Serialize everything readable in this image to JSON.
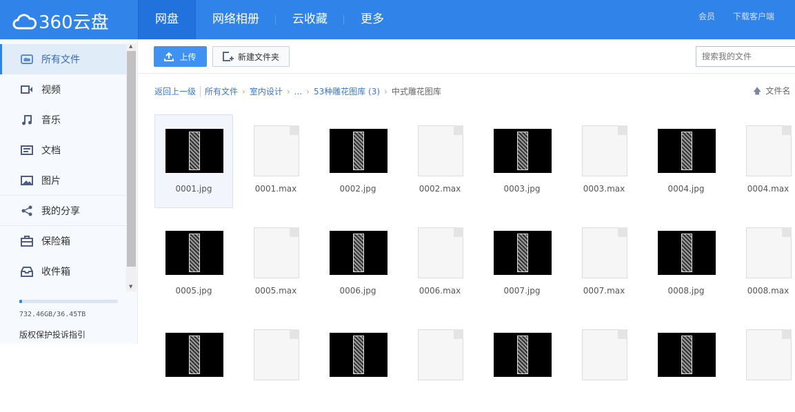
{
  "header": {
    "logo": "360云盘",
    "nav": [
      "网盘",
      "网络相册",
      "云收藏",
      "更多"
    ],
    "right": [
      "会员",
      "下载客户端"
    ]
  },
  "sidebar": {
    "items": [
      {
        "label": "所有文件",
        "icon": "folder-cloud-icon"
      },
      {
        "label": "视频",
        "icon": "video-icon"
      },
      {
        "label": "音乐",
        "icon": "music-icon"
      },
      {
        "label": "文档",
        "icon": "document-icon"
      },
      {
        "label": "图片",
        "icon": "image-icon"
      },
      {
        "label": "我的分享",
        "icon": "share-icon"
      },
      {
        "label": "保险箱",
        "icon": "safe-icon"
      },
      {
        "label": "收件箱",
        "icon": "inbox-icon"
      }
    ],
    "quota_text": "732.46GB/36.45TB",
    "quota_percent": 2,
    "copyright": "版权保护投诉指引"
  },
  "toolbar": {
    "upload": "上传",
    "new_folder": "新建文件夹",
    "search_placeholder": "搜索我的文件"
  },
  "breadcrumb": {
    "back": "返回上一级",
    "items": [
      "所有文件",
      "室内设计",
      "...",
      "53种雕花图库 (3)"
    ],
    "current": "中式雕花图库"
  },
  "sort": {
    "label": "文件名"
  },
  "files": [
    {
      "name": "0001.jpg",
      "type": "jpg"
    },
    {
      "name": "0001.max",
      "type": "max"
    },
    {
      "name": "0002.jpg",
      "type": "jpg"
    },
    {
      "name": "0002.max",
      "type": "max"
    },
    {
      "name": "0003.jpg",
      "type": "jpg"
    },
    {
      "name": "0003.max",
      "type": "max"
    },
    {
      "name": "0004.jpg",
      "type": "jpg"
    },
    {
      "name": "0004.max",
      "type": "max"
    },
    {
      "name": "0005.jpg",
      "type": "jpg"
    },
    {
      "name": "0005.max",
      "type": "max"
    },
    {
      "name": "0006.jpg",
      "type": "jpg"
    },
    {
      "name": "0006.max",
      "type": "max"
    },
    {
      "name": "0007.jpg",
      "type": "jpg"
    },
    {
      "name": "0007.max",
      "type": "max"
    },
    {
      "name": "0008.jpg",
      "type": "jpg"
    },
    {
      "name": "0008.max",
      "type": "max"
    },
    {
      "name": "",
      "type": "jpg"
    },
    {
      "name": "",
      "type": "max"
    },
    {
      "name": "",
      "type": "jpg"
    },
    {
      "name": "",
      "type": "max"
    },
    {
      "name": "",
      "type": "jpg"
    },
    {
      "name": "",
      "type": "max"
    },
    {
      "name": "",
      "type": "jpg"
    },
    {
      "name": "",
      "type": "max"
    }
  ]
}
